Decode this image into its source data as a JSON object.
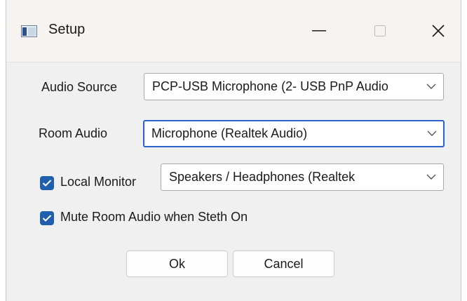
{
  "window": {
    "title": "Setup",
    "icon": "app-window-icon",
    "controls": {
      "minimize": "minimize-icon",
      "maximize": "maximize-icon",
      "close": "close-icon"
    }
  },
  "form": {
    "audio_source": {
      "label": "Audio Source",
      "value": "PCP-USB Microphone (2- USB PnP Audio"
    },
    "room_audio": {
      "label": "Room Audio",
      "value": "Microphone (Realtek Audio)"
    },
    "local_monitor": {
      "label": "Local Monitor",
      "checked": true,
      "value": "Speakers / Headphones (Realtek"
    },
    "mute_room_audio": {
      "label": "Mute Room Audio when Steth On",
      "checked": true
    }
  },
  "buttons": {
    "ok": "Ok",
    "cancel": "Cancel"
  },
  "colors": {
    "accent": "#1f5fae",
    "focus_border": "#2c62c9",
    "titlebar": "#f7f3f1",
    "dialog_bg": "#f0f0f0"
  }
}
